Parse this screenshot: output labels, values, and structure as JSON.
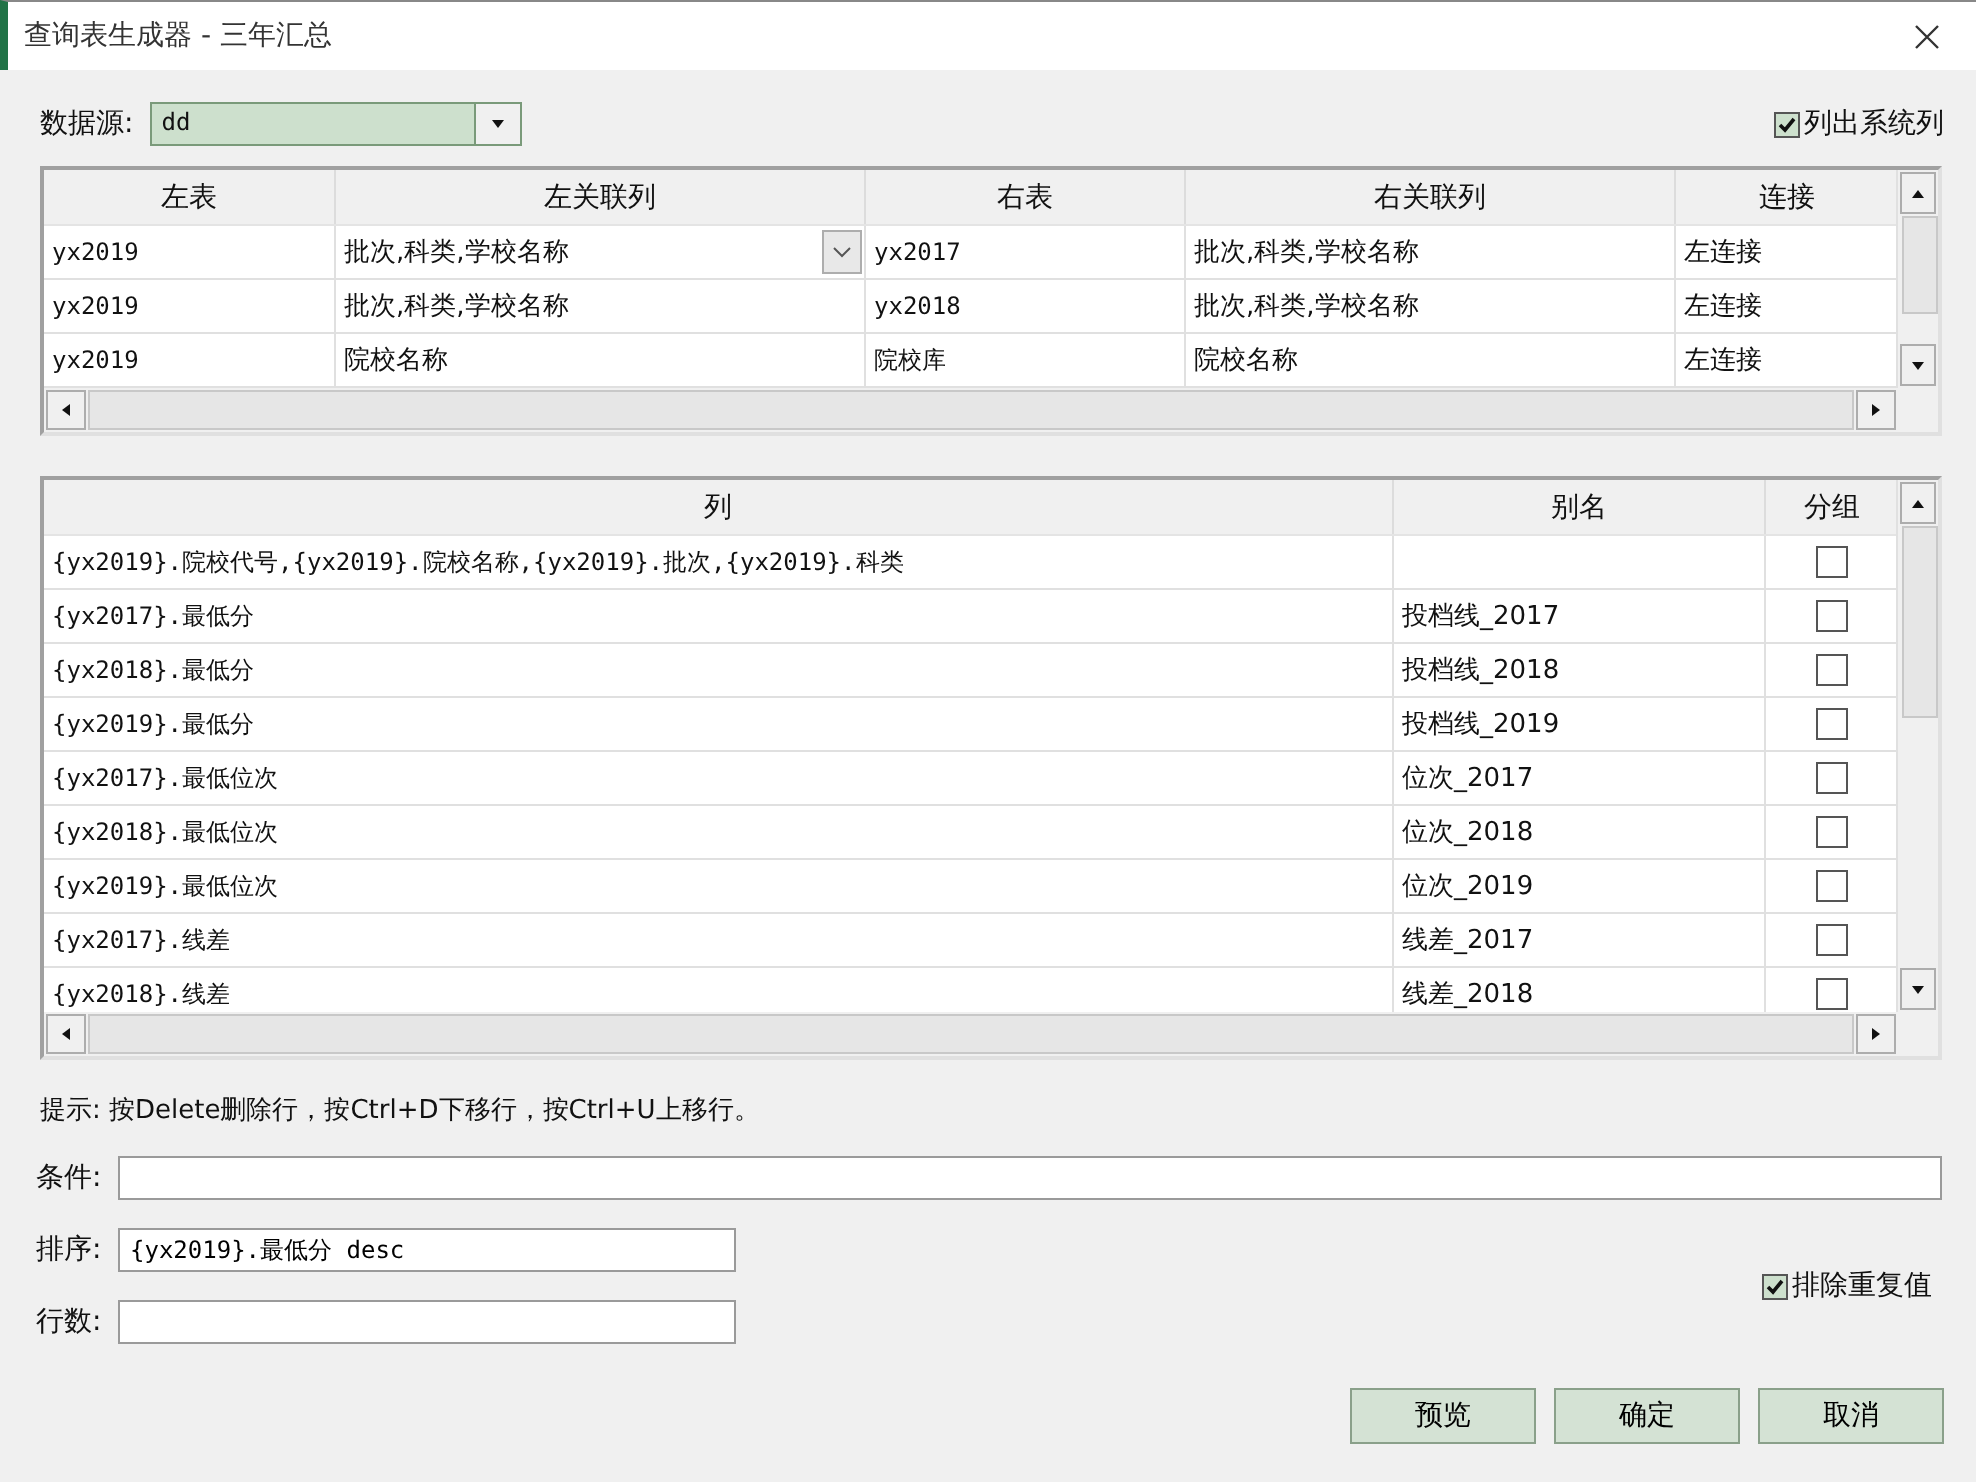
{
  "window": {
    "title": "查询表生成器 - 三年汇总"
  },
  "data_source": {
    "label": "数据源:",
    "value": "dd"
  },
  "list_system_columns": {
    "label": "列出系统列",
    "checked": true
  },
  "joins": {
    "columns": [
      "左表",
      "左关联列",
      "右表",
      "右关联列",
      "连接"
    ],
    "rows": [
      {
        "cells": [
          "yx2019",
          "批次,科类,学校名称",
          "yx2017",
          "批次,科类,学校名称",
          "左连接"
        ],
        "editing": true
      },
      {
        "cells": [
          "yx2019",
          "批次,科类,学校名称",
          "yx2018",
          "批次,科类,学校名称",
          "左连接"
        ],
        "editing": false
      },
      {
        "cells": [
          "yx2019",
          "院校名称",
          "院校库",
          "院校名称",
          "左连接"
        ],
        "editing": false
      }
    ]
  },
  "columns_table": {
    "columns": [
      "列",
      "别名",
      "分组"
    ],
    "rows": [
      {
        "column": "{yx2019}.院校代号,{yx2019}.院校名称,{yx2019}.批次,{yx2019}.科类",
        "group": false
      },
      {
        "column": "{yx2017}.最低分",
        "alias": "投档线_2017",
        "group": false
      },
      {
        "column": "{yx2018}.最低分",
        "alias": "投档线_2018",
        "group": false
      },
      {
        "column": "{yx2019}.最低分",
        "alias": "投档线_2019",
        "group": false
      },
      {
        "column": "{yx2017}.最低位次",
        "alias": "位次_2017",
        "group": false
      },
      {
        "column": "{yx2018}.最低位次",
        "alias": "位次_2018",
        "group": false
      },
      {
        "column": "{yx2019}.最低位次",
        "alias": "位次_2019",
        "group": false
      },
      {
        "column": "{yx2017}.线差",
        "alias": "线差_2017",
        "group": false
      },
      {
        "column": "{yx2018}.线差",
        "alias": "线差_2018",
        "group": false
      }
    ]
  },
  "hint": "提示: 按Delete删除行，按Ctrl+D下移行，按Ctrl+U上移行。",
  "condition": {
    "label": "条件:"
  },
  "sort": {
    "label": "排序:",
    "value": "{yx2019}.最低分 desc"
  },
  "row_count": {
    "label": "行数:"
  },
  "exclude_duplicates": {
    "label": "排除重复值",
    "checked": true
  },
  "buttons": [
    "预览",
    "确定",
    "取消"
  ]
}
